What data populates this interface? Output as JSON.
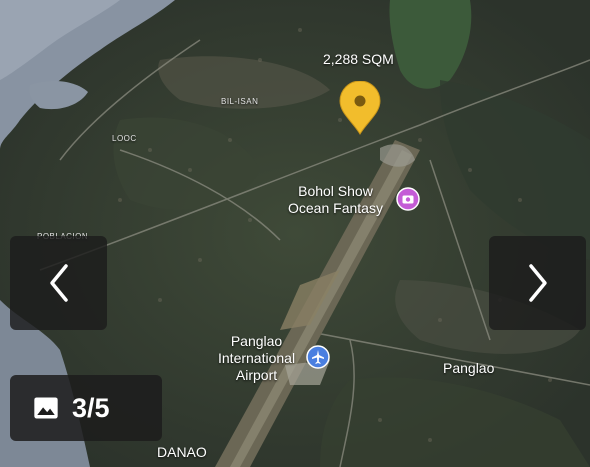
{
  "map": {
    "area_label": "2,288 SQM",
    "places": {
      "bil_isan": "BIL-ISAN",
      "looc": "LOOC",
      "poblacion": "POBLACION",
      "danao": "DANAO",
      "panglao": "Panglao"
    },
    "poi": {
      "bohol_show_line1": "Bohol Show",
      "bohol_show_line2": "Ocean Fantasy",
      "airport_line1": "Panglao",
      "airport_line2": "International",
      "airport_line3": "Airport"
    }
  },
  "gallery": {
    "counter": "3/5"
  },
  "colors": {
    "pin": "#f2bd2c",
    "poi_purple": "#c45bd6",
    "airport_blue": "#4a7fe0"
  },
  "icons": [
    "map-pin-icon",
    "camera-poi-icon",
    "airplane-icon",
    "chevron-left-icon",
    "chevron-right-icon",
    "image-icon"
  ]
}
